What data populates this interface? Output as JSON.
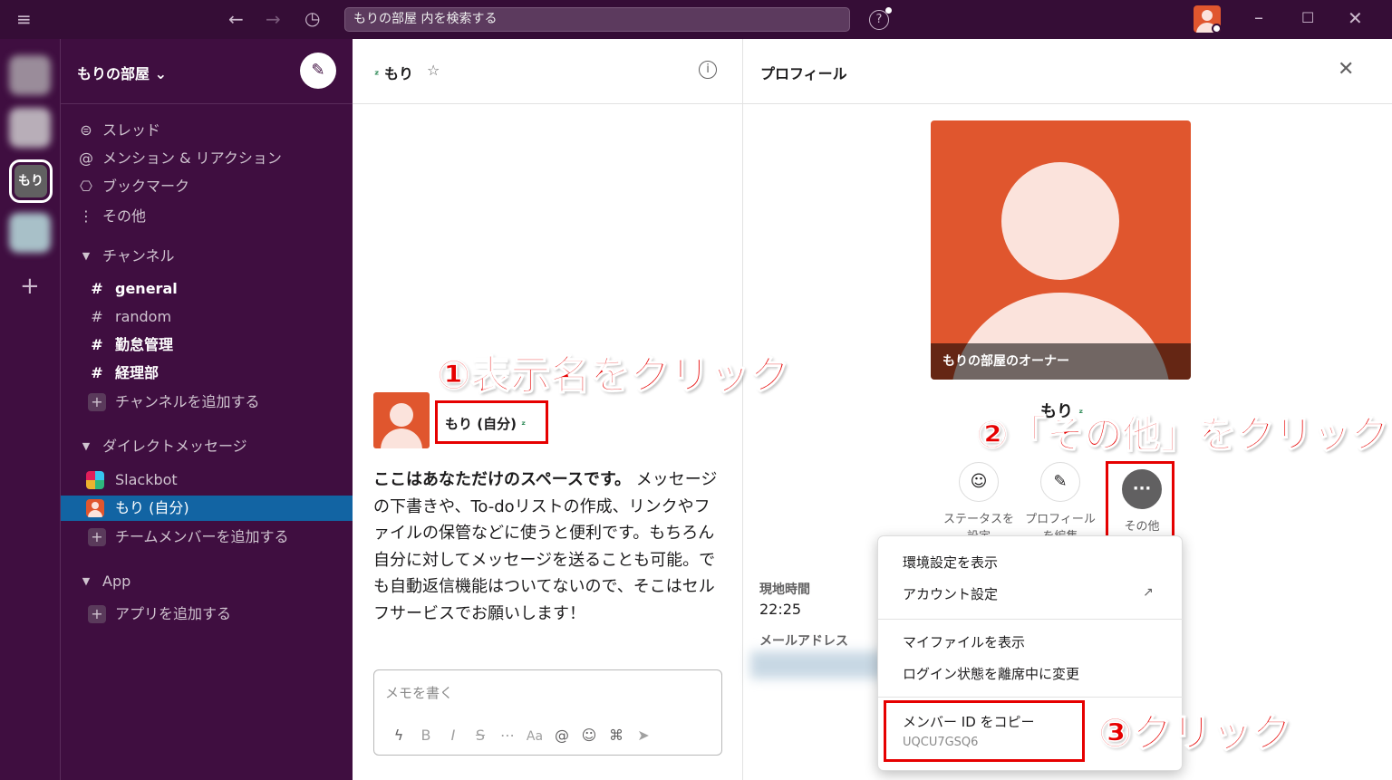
{
  "titlebar": {
    "search_placeholder": "もりの部屋 内を検索する",
    "help": "?"
  },
  "rail": {
    "active_workspace": "もり",
    "add": "+"
  },
  "sidebar": {
    "workspace_name": "もりの部屋 ⌄",
    "nav": [
      {
        "icon": "threads-icon",
        "glyph": "⊜",
        "label": "スレッド"
      },
      {
        "icon": "mention-icon",
        "glyph": "@",
        "label": "メンション & リアクション"
      },
      {
        "icon": "bookmark-icon",
        "glyph": "⎔",
        "label": "ブックマーク"
      },
      {
        "icon": "more-vertical-icon",
        "glyph": "⋮",
        "label": "その他"
      }
    ],
    "channels_header": "チャンネル",
    "channels": [
      "general",
      "random",
      "勤怠管理",
      "経理部"
    ],
    "add_channel": "チャンネルを追加する",
    "dm_header": "ダイレクトメッセージ",
    "dms": [
      "Slackbot",
      "もり (自分)"
    ],
    "add_member": "チームメンバーを追加する",
    "app_header": "App",
    "add_app": "アプリを追加する"
  },
  "channel": {
    "name": "もり",
    "display_name": "もり (自分)",
    "intro_bold": "ここはあなただけのスペースです。",
    "intro_rest": " メッセージの下書きや、To-doリストの作成、リンクやファイルの保管などに使うと便利です。もちろん自分に対してメッセージを送ることも可能。でも自動返信機能はついてないので、そこはセルフサービスでお願いします！",
    "composer_placeholder": "メモを書く",
    "toolbar": [
      "ϟ",
      "B",
      "I",
      "S",
      "⋯",
      "Aa",
      "@",
      "☺",
      "⌘",
      "➤"
    ]
  },
  "profile": {
    "title": "プロフィール",
    "caption": "もりの部屋のオーナー",
    "name": "もり",
    "actions": [
      "ステータスを設定",
      "プロフィールを編集",
      "その他"
    ],
    "local_time_label": "現地時間",
    "local_time": "22:25",
    "email_label": "メールアドレス"
  },
  "menu": {
    "items": [
      "環境設定を表示",
      "アカウント設定",
      "マイファイルを表示",
      "ログイン状態を離席中に変更",
      "メンバー ID をコピー"
    ],
    "member_id": "UQCU7GSQ6"
  },
  "annotations": {
    "step1": "①表示名をクリック",
    "step2": "②「その他」をクリック",
    "step3": "③クリック"
  },
  "colors": {
    "sidebar": "#3f0e40",
    "active": "#1264a3",
    "avatar": "#e0562e",
    "annotation": "#e60000"
  }
}
